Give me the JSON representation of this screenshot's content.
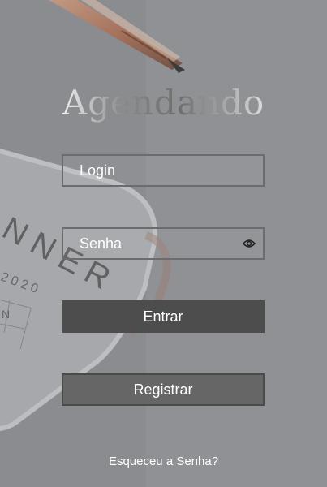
{
  "app": {
    "title": "Agendando"
  },
  "form": {
    "login_placeholder": "Login",
    "password_placeholder": "Senha",
    "password_toggle_icon": "eye-icon",
    "submit_label": "Entrar",
    "register_label": "Registrar",
    "forgot_label": "Esqueceu a Senha?"
  },
  "background": {
    "planner_word": "NNER",
    "planner_year": "2020",
    "planner_letter": "N"
  },
  "colors": {
    "overlay": "#8c8d90",
    "submit_bg": "#4d4d4d",
    "register_bg": "#666666",
    "field_border": "#6c6c6c",
    "text": "#ffffff"
  }
}
